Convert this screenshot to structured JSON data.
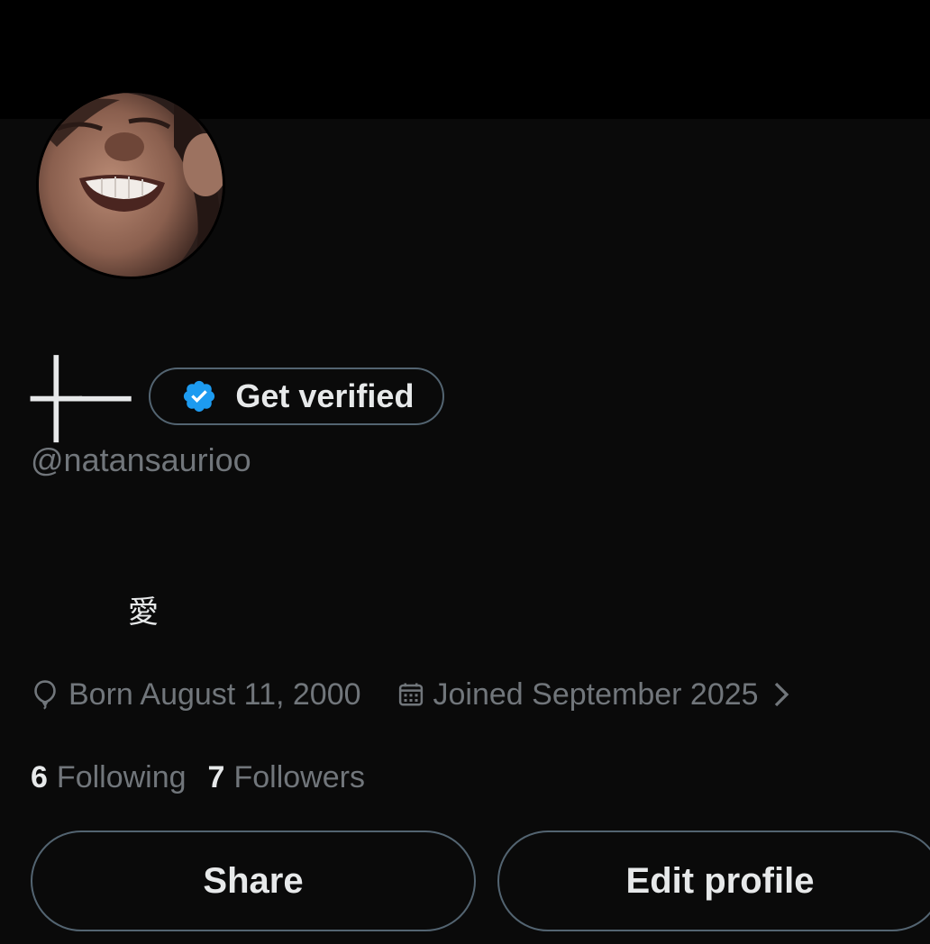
{
  "profile": {
    "display_name": "┼─",
    "handle": "@natansaurioo",
    "bio": "愛",
    "get_verified_label": "Get verified"
  },
  "meta": {
    "born": "Born August 11, 2000",
    "joined": "Joined September 2025"
  },
  "stats": {
    "following_count": "6",
    "following_label": "Following",
    "followers_count": "7",
    "followers_label": "Followers"
  },
  "actions": {
    "share_label": "Share",
    "edit_profile_label": "Edit profile"
  },
  "colors": {
    "background": "#000000",
    "text_primary": "#e7e9ea",
    "text_secondary": "#71767b",
    "border": "#536471",
    "verified_blue": "#1d9bf0"
  },
  "icons": [
    "verified-badge-icon",
    "balloon-icon",
    "calendar-icon",
    "chevron-right-icon"
  ]
}
